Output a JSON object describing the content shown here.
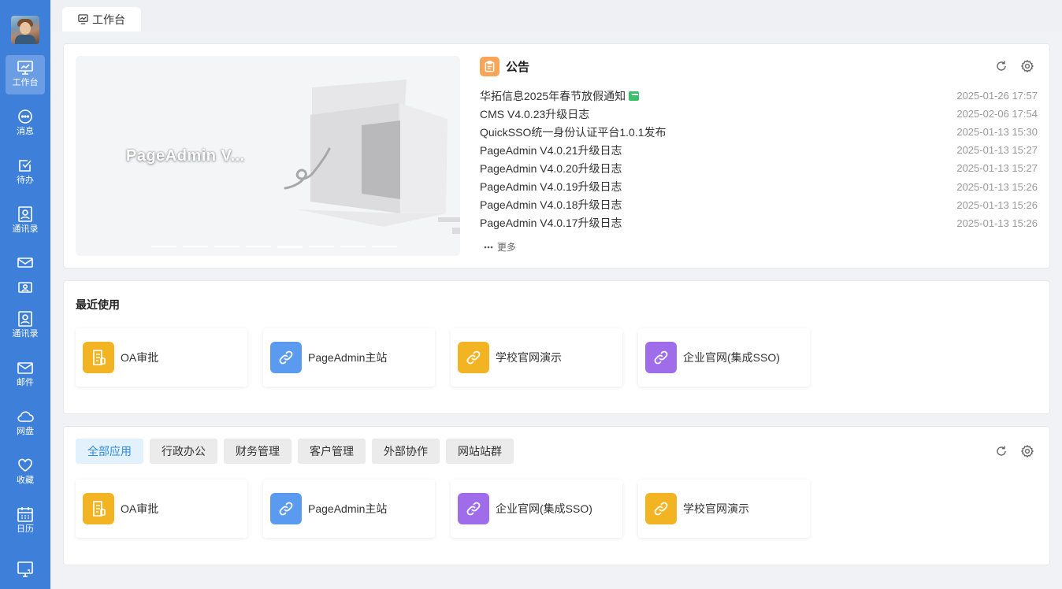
{
  "sidebar": {
    "items": [
      {
        "label": "工作台",
        "icon": "monitor-chart-icon"
      },
      {
        "label": "消息",
        "icon": "chat-bubble-icon"
      },
      {
        "label": "待办",
        "icon": "checkbox-icon"
      },
      {
        "label": "通讯录",
        "icon": "contact-card-icon"
      },
      {
        "label": "",
        "icon": "mail-icon"
      },
      {
        "label": "",
        "icon": "id-card-icon"
      },
      {
        "label": "通讯录",
        "icon": "contact-card-icon"
      },
      {
        "label": "邮件",
        "icon": "mail-icon"
      },
      {
        "label": "网盘",
        "icon": "cloud-icon"
      },
      {
        "label": "收藏",
        "icon": "heart-icon"
      },
      {
        "label": "日历",
        "icon": "calendar-icon"
      },
      {
        "label": "",
        "icon": "screen-icon"
      }
    ]
  },
  "tabs": {
    "active": "工作台"
  },
  "banner": {
    "title": "PageAdmin V..."
  },
  "notice": {
    "title": "公告",
    "more_label": "更多",
    "items": [
      {
        "title": "华拓信息2025年春节放假通知",
        "date": "2025-01-26 17:57",
        "is_new": true
      },
      {
        "title": "CMS V4.0.23升级日志",
        "date": "2025-02-06 17:54"
      },
      {
        "title": "QuickSSO统一身份认证平台1.0.1发布",
        "date": "2025-01-13 15:30"
      },
      {
        "title": "PageAdmin V4.0.21升级日志",
        "date": "2025-01-13 15:27"
      },
      {
        "title": "PageAdmin V4.0.20升级日志",
        "date": "2025-01-13 15:27"
      },
      {
        "title": "PageAdmin V4.0.19升级日志",
        "date": "2025-01-13 15:26"
      },
      {
        "title": "PageAdmin V4.0.18升级日志",
        "date": "2025-01-13 15:26"
      },
      {
        "title": "PageAdmin V4.0.17升级日志",
        "date": "2025-01-13 15:26"
      }
    ]
  },
  "recent": {
    "title": "最近使用",
    "apps": [
      {
        "name": "OA审批",
        "color": "#f3b423",
        "icon": "document-icon"
      },
      {
        "name": "PageAdmin主站",
        "color": "#5b9bef",
        "icon": "link-icon"
      },
      {
        "name": "学校官网演示",
        "color": "#f3b423",
        "icon": "link-icon"
      },
      {
        "name": "企业官网(集成SSO)",
        "color": "#9f6de9",
        "icon": "link-icon"
      }
    ]
  },
  "apps": {
    "filters": [
      "全部应用",
      "行政办公",
      "财务管理",
      "客户管理",
      "外部协作",
      "网站站群"
    ],
    "active_filter": "全部应用",
    "items": [
      {
        "name": "OA审批",
        "color": "#f3b423",
        "icon": "document-icon"
      },
      {
        "name": "PageAdmin主站",
        "color": "#5b9bef",
        "icon": "link-icon"
      },
      {
        "name": "企业官网(集成SSO)",
        "color": "#9f6de9",
        "icon": "link-icon"
      },
      {
        "name": "学校官网演示",
        "color": "#f3b423",
        "icon": "link-icon"
      }
    ]
  },
  "colors": {
    "sidebar": "#3d7fd9",
    "sidebar_active": "#6a9de4",
    "filter_active_text": "#2f89e0"
  }
}
